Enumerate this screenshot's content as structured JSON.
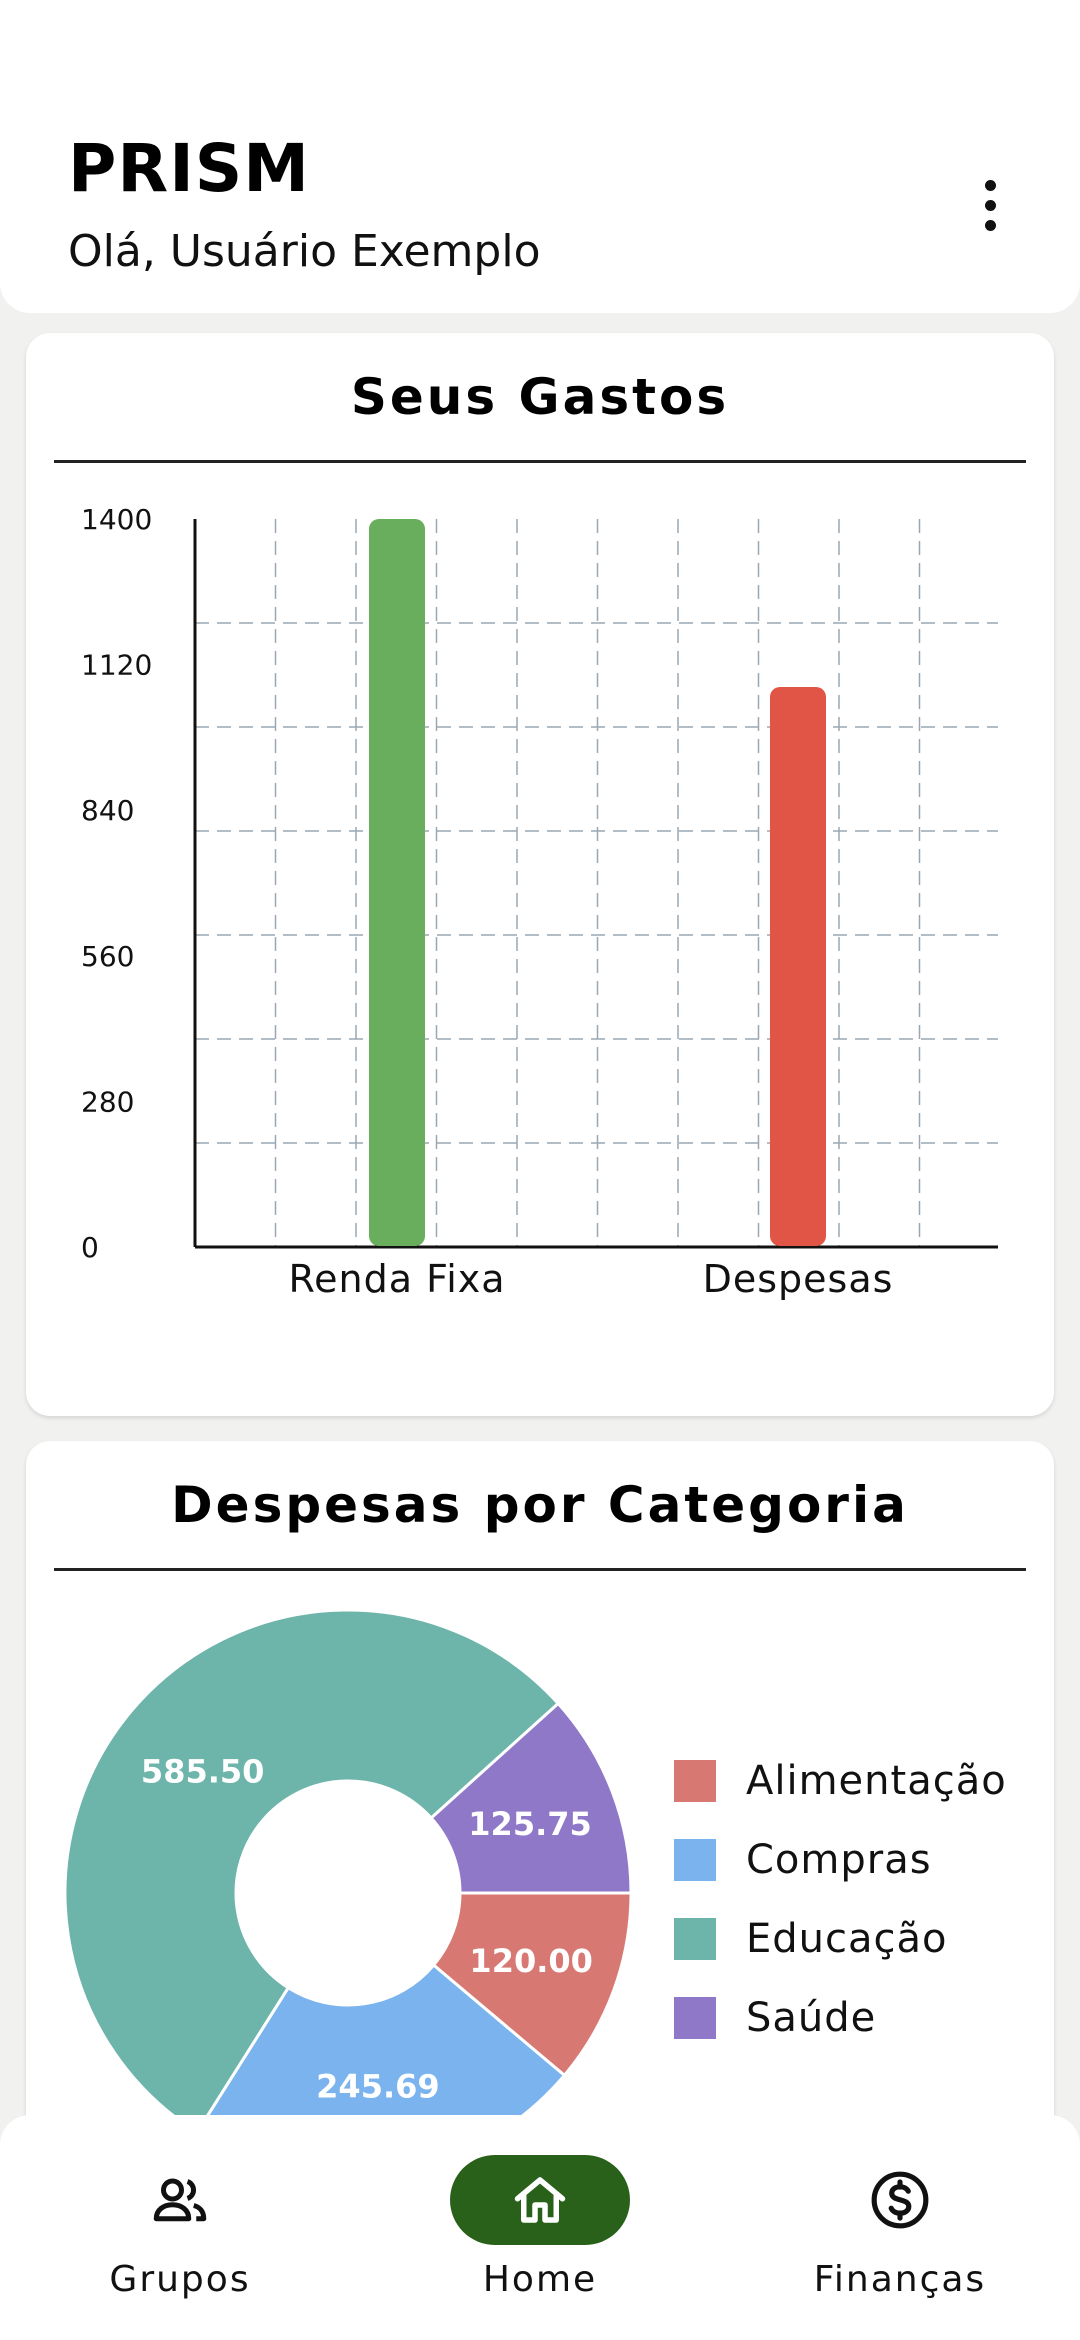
{
  "header": {
    "app_title": "PRISM",
    "greeting": "Olá, Usuário Exemplo",
    "menu_icon": "more-vertical-icon"
  },
  "spending_card": {
    "title": "Seus Gastos"
  },
  "category_card": {
    "title": "Despesas por Categoria"
  },
  "chart_data": [
    {
      "type": "bar",
      "categories": [
        "Renda Fixa",
        "Despesas"
      ],
      "values": [
        1400,
        1077
      ],
      "colors": [
        "#68ae5c",
        "#e05545"
      ],
      "ylim": [
        0,
        1400
      ],
      "yticks": [
        0,
        280,
        560,
        840,
        1120,
        1400
      ],
      "grid": true
    },
    {
      "type": "pie",
      "style": "donut",
      "labels": [
        "Alimentação",
        "Compras",
        "Educação",
        "Saúde"
      ],
      "values": [
        120.0,
        245.69,
        585.5,
        125.75
      ],
      "value_labels": [
        "120.00",
        "245.69",
        "585.50",
        "125.75"
      ],
      "colors": [
        "#d77873",
        "#7ab3ee",
        "#6db4aa",
        "#8f78c8"
      ],
      "legend_position": "right"
    }
  ],
  "bottom_nav": {
    "items": [
      {
        "label": "Grupos",
        "icon": "groups-icon",
        "active": false
      },
      {
        "label": "Home",
        "icon": "home-icon",
        "active": true
      },
      {
        "label": "Finanças",
        "icon": "dollar-icon",
        "active": false
      }
    ]
  }
}
